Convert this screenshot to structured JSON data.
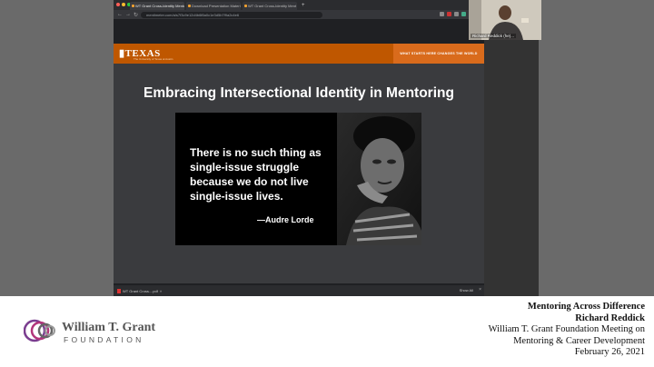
{
  "browser": {
    "tabs": [
      {
        "label": "WT Grant Cross-Identity Mentor",
        "active": true
      },
      {
        "label": "Download Presentation Materi",
        "active": false
      },
      {
        "label": "WT Grant Cross-Identity Ment",
        "active": false
      }
    ],
    "url": "mentimeter.com/a/s7f3c9e12d4b6f8a0c1e3d5b7f9a2c4e6",
    "download": {
      "file": "WT Grant Cross....pdf",
      "show_all": "Show All"
    }
  },
  "slide": {
    "brand": "TEXAS",
    "brand_sub": "The University of Texas at Austin",
    "tagline": "WHAT STARTS HERE CHANGES THE WORLD",
    "title": "Embracing Intersectional Identity in Mentoring",
    "quote": "There is no such thing as single-issue struggle because we do not live single-issue lives.",
    "author": "—Audre Lorde"
  },
  "video": {
    "name": "Richard Reddick (he)..."
  },
  "footer": {
    "org_name": "William T. Grant",
    "org_sub": "FOUNDATION",
    "line1": "Mentoring Across Difference",
    "line2": "Richard Reddick",
    "line3": "William T. Grant Foundation Meeting on",
    "line4": "Mentoring & Career Development",
    "line5": "February 26, 2021"
  },
  "colors": {
    "brand_orange": "#bf5700",
    "slide_bg": "#3a3b3e"
  }
}
